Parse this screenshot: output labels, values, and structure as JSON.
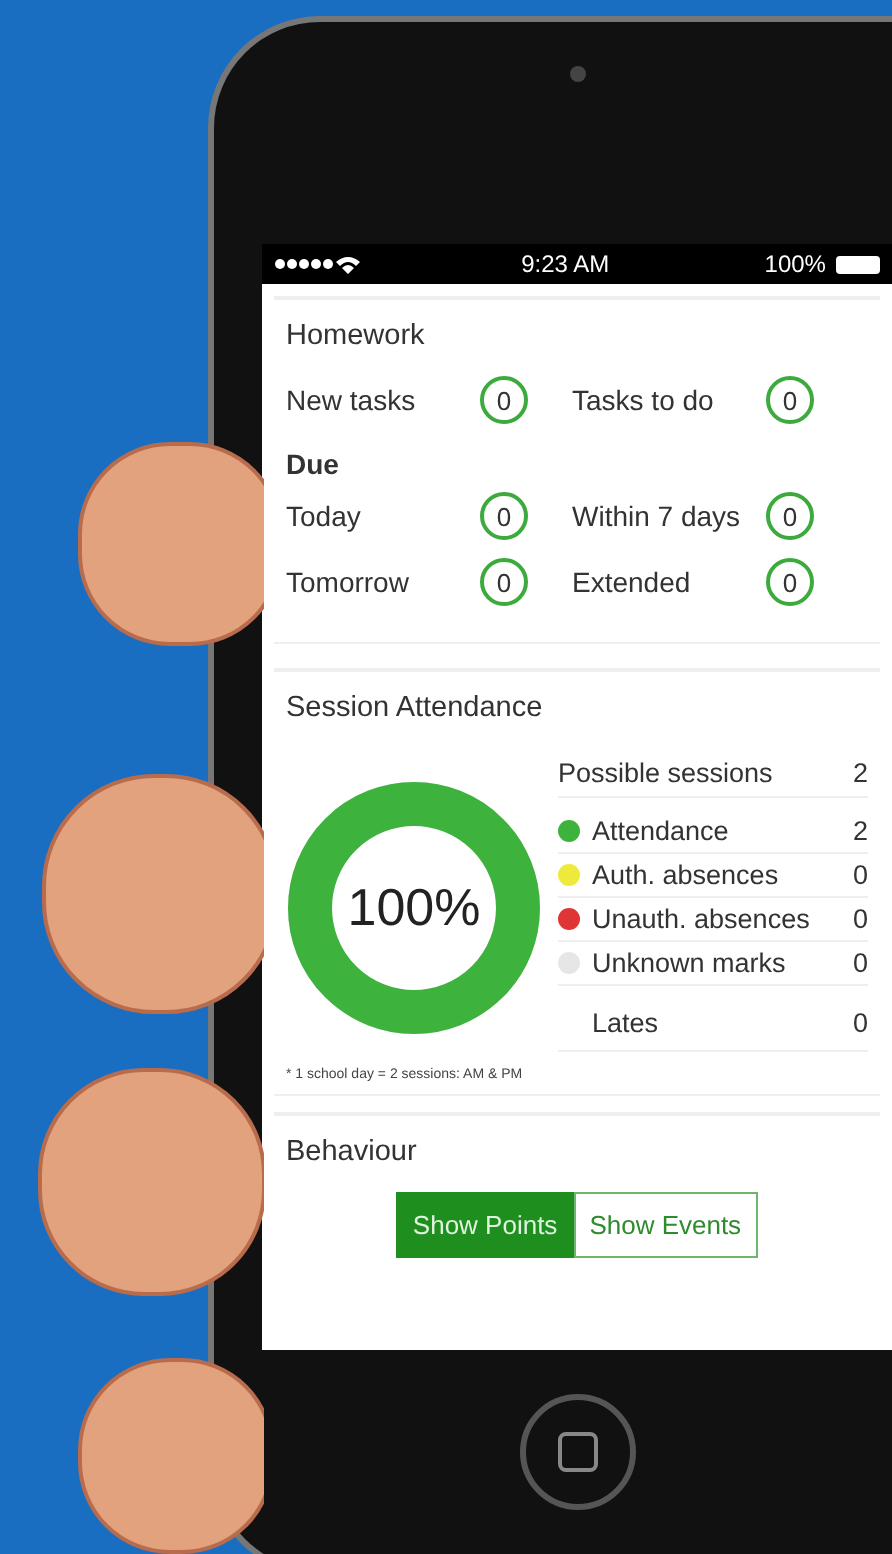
{
  "status_bar": {
    "time": "9:23 AM",
    "battery": "100%"
  },
  "homework": {
    "title": "Homework",
    "tasks": [
      {
        "label": "New tasks",
        "count": "0"
      },
      {
        "label": "Tasks to do",
        "count": "0"
      }
    ],
    "due_heading": "Due",
    "due": [
      {
        "label": "Today",
        "count": "0"
      },
      {
        "label": "Within 7 days",
        "count": "0"
      },
      {
        "label": "Tomorrow",
        "count": "0"
      },
      {
        "label": "Extended",
        "count": "0"
      }
    ]
  },
  "attendance": {
    "title": "Session Attendance",
    "ring": {
      "label": "100%",
      "level": 1
    },
    "rows": [
      {
        "kind": "total",
        "label": "Possible sessions",
        "value": "2"
      },
      {
        "kind": "legend",
        "label": "Attendance",
        "value": "2",
        "color": "#3db33d"
      },
      {
        "kind": "legend",
        "label": "Auth. absences",
        "value": "0",
        "color": "#eeea3c"
      },
      {
        "kind": "legend",
        "label": "Unauth. absences",
        "value": "0",
        "color": "#e03535"
      },
      {
        "kind": "legend",
        "label": "Unknown marks",
        "value": "0",
        "color": "#e6e6e6"
      },
      {
        "kind": "plain",
        "label": "Lates",
        "value": "0"
      }
    ],
    "footnote": "* 1 school day = 2 sessions: AM & PM"
  },
  "behaviour": {
    "title": "Behaviour",
    "toggles": [
      {
        "label": "Show Points",
        "selected": true
      },
      {
        "label": "Show Events",
        "selected": false
      }
    ]
  }
}
